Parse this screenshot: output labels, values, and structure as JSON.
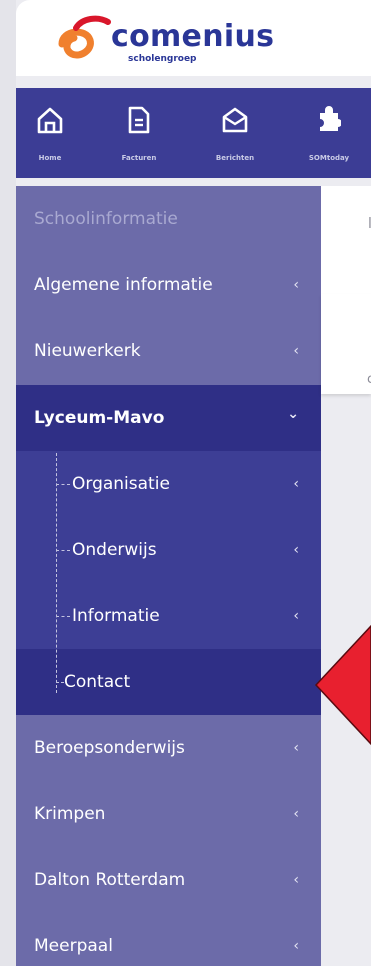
{
  "brand": {
    "name": "comenius",
    "subtitle": "scholengroep",
    "colors": {
      "orange": "#f0802e",
      "red": "#d9172b",
      "navy": "#2a3697"
    }
  },
  "topnav": {
    "items": [
      {
        "label": "Home",
        "icon": "home-icon"
      },
      {
        "label": "Facturen",
        "icon": "document-icon"
      },
      {
        "label": "Berichten",
        "icon": "envelope-icon"
      },
      {
        "label": "SOMtoday",
        "icon": "puzzle-icon"
      }
    ],
    "color": "#3c3d95"
  },
  "sidebar": {
    "header": "Schoolinformatie",
    "items": [
      {
        "label": "Algemene informatie",
        "chevron": "‹"
      },
      {
        "label": "Nieuwerkerk",
        "chevron": "‹"
      },
      {
        "label": "Lyceum-Mavo",
        "chevron": "⌄",
        "expanded": true
      },
      {
        "label": "Organisatie",
        "chevron": "‹"
      },
      {
        "label": "Onderwijs",
        "chevron": "‹"
      },
      {
        "label": "Informatie",
        "chevron": "‹"
      },
      {
        "label": "Contact"
      },
      {
        "label": "Beroepsonderwijs",
        "chevron": "‹"
      },
      {
        "label": "Krimpen",
        "chevron": "‹"
      },
      {
        "label": "Dalton Rotterdam",
        "chevron": "‹"
      },
      {
        "label": "Meerpaal",
        "chevron": "‹"
      }
    ],
    "colors": {
      "base": "#6c6ba9",
      "active": "#2f2f86",
      "sub": "#3d3e95"
    }
  },
  "annotation": {
    "color": "#e8202f"
  }
}
